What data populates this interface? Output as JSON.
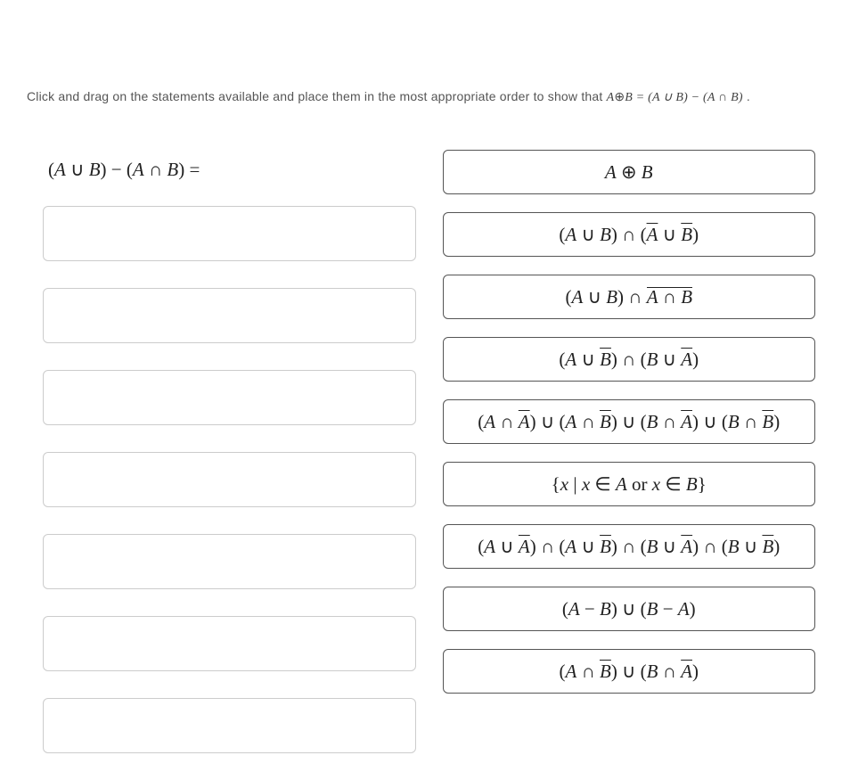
{
  "instructions": {
    "pre": "Click and drag on the statements available and place them in the most appropriate order to show that ",
    "equation_html": "<span class='it'>A</span><span class='sym'>⊕</span><span class='it'>B</span> = (<span class='it'>A</span> ∪ <span class='it'>B</span>) − (<span class='it'>A</span> ∩ <span class='it'>B</span>)",
    "post": "."
  },
  "lhs_html": "(<span class='it'>A</span> ∪ <span class='it'>B</span>) − (<span class='it'>A</span> ∩ <span class='it'>B</span>) =",
  "drop_slot_count": 7,
  "cards": [
    {
      "html": "<span class='it'>A</span> <span class='sym'>⊕</span> <span class='it'>B</span>"
    },
    {
      "html": "(<span class='it'>A</span> ∪ <span class='it'>B</span>) ∩ (<span class='it ol'>A</span> ∪ <span class='it ol'>B</span>)"
    },
    {
      "html": "(<span class='it'>A</span> ∪ <span class='it'>B</span>) ∩ <span class='olblock'><span class='it'>A</span> ∩ <span class='it'>B</span></span>"
    },
    {
      "html": "(<span class='it'>A</span> ∪ <span class='it ol'>B</span>) ∩ (<span class='it'>B</span> ∪ <span class='it ol'>A</span>)"
    },
    {
      "html": "(<span class='it'>A</span> ∩ <span class='it ol'>A</span>) ∪ (<span class='it'>A</span> ∩ <span class='it ol'>B</span>) ∪ (<span class='it'>B</span> ∩ <span class='it ol'>A</span>) ∪ (<span class='it'>B</span> ∩ <span class='it ol'>B</span>)"
    },
    {
      "html": "{<span class='it'>x</span> | <span class='it'>x</span> ∈ <span class='it'>A</span> or <span class='it'>x</span> ∈ <span class='it'>B</span>}"
    },
    {
      "html": "(<span class='it'>A</span> ∪ <span class='it ol'>A</span>) ∩ (<span class='it'>A</span> ∪ <span class='it ol'>B</span>) ∩ (<span class='it'>B</span> ∪ <span class='it ol'>A</span>) ∩ (<span class='it'>B</span> ∪ <span class='it ol'>B</span>)"
    },
    {
      "html": "(<span class='it'>A</span> − <span class='it'>B</span>) ∪ (<span class='it'>B</span> − <span class='it'>A</span>)"
    },
    {
      "html": "(<span class='it'>A</span> ∩ <span class='it ol'>B</span>) ∪ (<span class='it'>B</span> ∩ <span class='it ol'>A</span>)"
    }
  ]
}
